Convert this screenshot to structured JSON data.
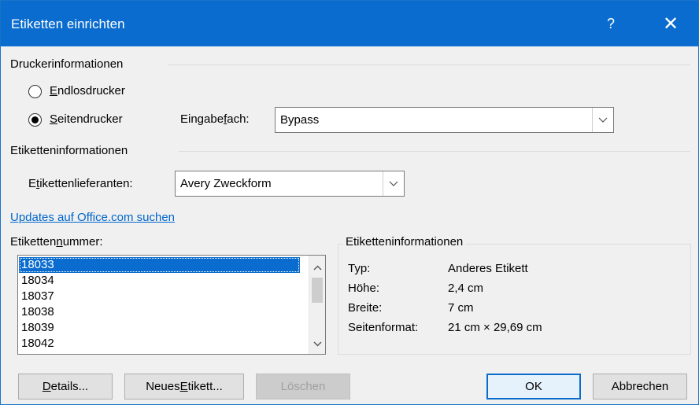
{
  "window": {
    "title": "Etiketten einrichten",
    "help": "?",
    "close": "✕"
  },
  "printer_info": {
    "heading": "Druckerinformationen",
    "continuous_label_pre": "",
    "continuous_label_u": "E",
    "continuous_label_post": "ndlosdrucker",
    "page_label_u": "S",
    "page_label_post": "eitendrucker",
    "selected": "Seitendrucker",
    "tray_label_pre": "Eingabe",
    "tray_label_u": "f",
    "tray_label_post": "ach:",
    "tray_value": "Bypass"
  },
  "label_info": {
    "heading": "Etiketteninformationen",
    "vendor_label_pre": "E",
    "vendor_label_u": "t",
    "vendor_label_post": "ikettenlieferanten:",
    "vendor_value": "Avery Zweckform",
    "update_link": "Updates auf Office.com suchen"
  },
  "label_number": {
    "label_pre": "Etiketten",
    "label_u": "n",
    "label_post": "ummer:",
    "items": [
      "18033",
      "18034",
      "18037",
      "18038",
      "18039",
      "18042"
    ],
    "selected": "18033"
  },
  "details_box": {
    "heading": "Etiketteninformationen",
    "rows": [
      {
        "key": "Typ:",
        "value": "Anderes Etikett"
      },
      {
        "key": "Höhe:",
        "value": "2,4 cm"
      },
      {
        "key": "Breite:",
        "value": "7 cm"
      },
      {
        "key": "Seitenformat:",
        "value": "21 cm × 29,69 cm"
      }
    ]
  },
  "buttons": {
    "details_u": "D",
    "details_post": "etails...",
    "new_pre": "Neues ",
    "new_u": "E",
    "new_post": "tikett...",
    "delete": "Löschen",
    "ok": "OK",
    "cancel": "Abbrechen"
  }
}
